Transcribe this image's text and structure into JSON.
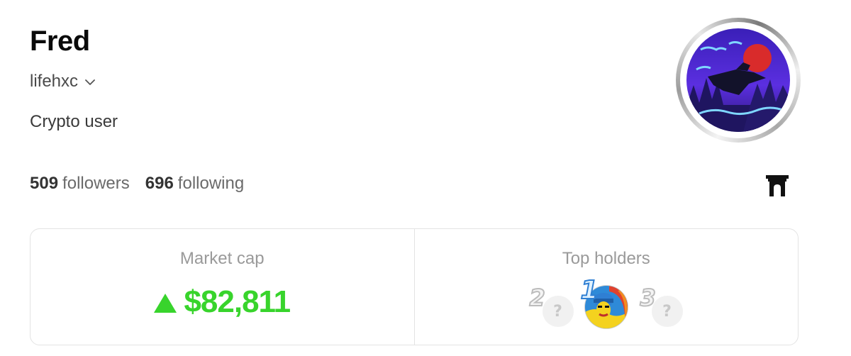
{
  "profile": {
    "name": "Fred",
    "handle": "lifehxc",
    "bio": "Crypto user"
  },
  "stats": {
    "followers_count": "509",
    "followers_label": "followers",
    "following_count": "696",
    "following_label": "following"
  },
  "card": {
    "market_cap_title": "Market cap",
    "market_cap_value": "$82,811",
    "market_cap_trend": "up",
    "top_holders_title": "Top holders",
    "holders": [
      {
        "rank": "2",
        "placeholder": "?"
      },
      {
        "rank": "1",
        "placeholder": ""
      },
      {
        "rank": "3",
        "placeholder": "?"
      }
    ]
  },
  "colors": {
    "accent_green": "#38d42c",
    "muted_text": "#9a9a9a"
  },
  "icons": {
    "handle_dropdown": "chevron-down-icon",
    "gate": "gate-icon"
  }
}
